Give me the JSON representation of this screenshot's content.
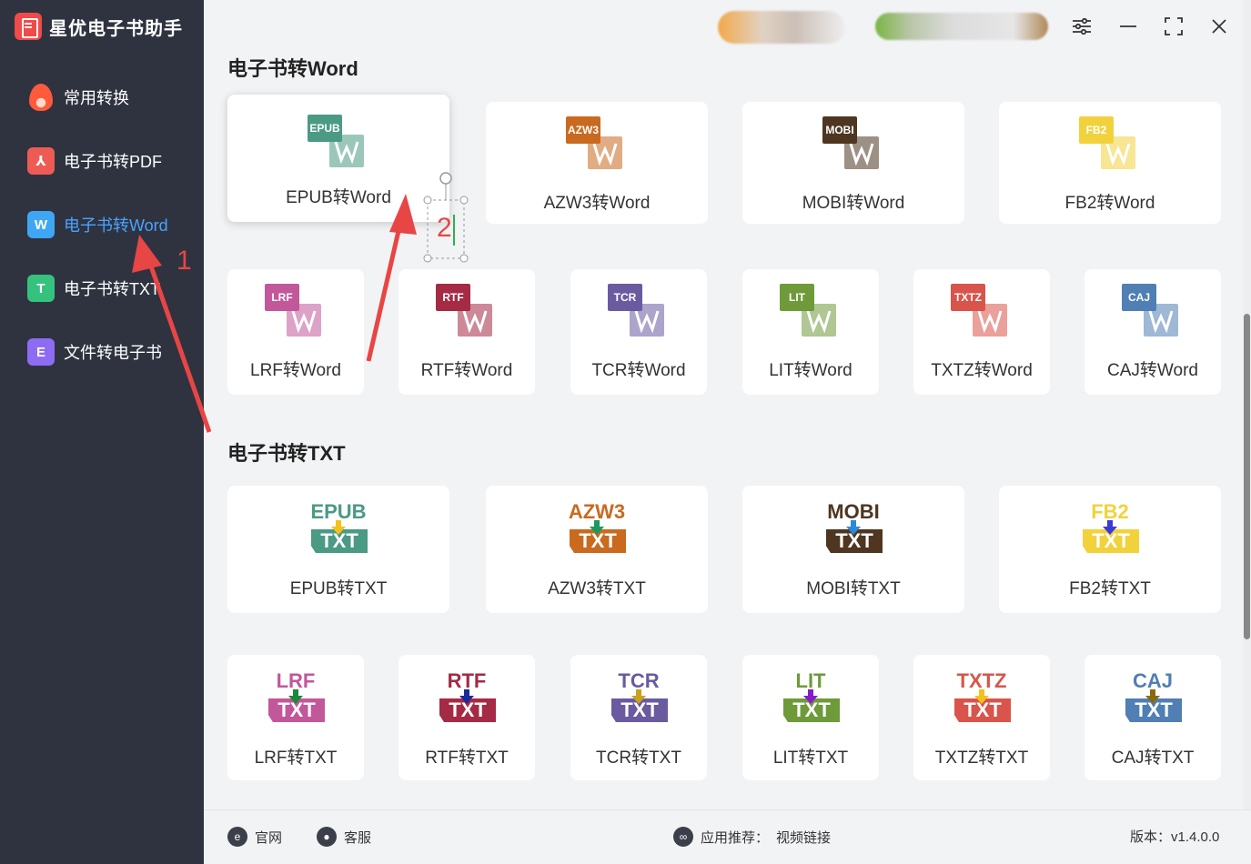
{
  "app": {
    "title": "星优电子书助手"
  },
  "sidebar": {
    "items": [
      {
        "label": "常用转换",
        "icon": "fire-icon"
      },
      {
        "label": "电子书转PDF",
        "icon": "pdf-icon"
      },
      {
        "label": "电子书转Word",
        "icon": "word-icon",
        "active": true
      },
      {
        "label": "电子书转TXT",
        "icon": "txt-icon"
      },
      {
        "label": "文件转电子书",
        "icon": "ebook-icon"
      }
    ]
  },
  "annotations": {
    "step1": "1",
    "step2": "2"
  },
  "sections": {
    "word": {
      "title": "电子书转Word",
      "cards": [
        {
          "fmt": "EPUB",
          "label": "EPUB转Word",
          "color": "#4a9a84"
        },
        {
          "fmt": "AZW3",
          "label": "AZW3转Word",
          "color": "#c96a1f"
        },
        {
          "fmt": "MOBI",
          "label": "MOBI转Word",
          "color": "#4e3621"
        },
        {
          "fmt": "FB2",
          "label": "FB2转Word",
          "color": "#f2d23c"
        },
        {
          "fmt": "LRF",
          "label": "LRF转Word",
          "color": "#c2579a"
        },
        {
          "fmt": "RTF",
          "label": "RTF转Word",
          "color": "#a52a44"
        },
        {
          "fmt": "TCR",
          "label": "TCR转Word",
          "color": "#6a5aa0"
        },
        {
          "fmt": "LIT",
          "label": "LIT转Word",
          "color": "#6e9a3a"
        },
        {
          "fmt": "TXTZ",
          "label": "TXTZ转Word",
          "color": "#d9544a"
        },
        {
          "fmt": "CAJ",
          "label": "CAJ转Word",
          "color": "#4f7fb3"
        }
      ]
    },
    "txt": {
      "title": "电子书转TXT",
      "cards": [
        {
          "fmt": "EPUB",
          "label": "EPUB转TXT",
          "color": "#4a9a84",
          "arrow": "#f2c21a"
        },
        {
          "fmt": "AZW3",
          "label": "AZW3转TXT",
          "color": "#c96a1f",
          "arrow": "#1a9a5a"
        },
        {
          "fmt": "MOBI",
          "label": "MOBI转TXT",
          "color": "#4e3621",
          "arrow": "#2a8ad9"
        },
        {
          "fmt": "FB2",
          "label": "FB2转TXT",
          "color": "#f2d23c",
          "arrow": "#3a3ad9"
        },
        {
          "fmt": "LRF",
          "label": "LRF转TXT",
          "color": "#c2579a",
          "arrow": "#1a8a3a"
        },
        {
          "fmt": "RTF",
          "label": "RTF转TXT",
          "color": "#a52a44",
          "arrow": "#1a2a9a"
        },
        {
          "fmt": "TCR",
          "label": "TCR转TXT",
          "color": "#6a5aa0",
          "arrow": "#c9a21a"
        },
        {
          "fmt": "LIT",
          "label": "LIT转TXT",
          "color": "#6e9a3a",
          "arrow": "#8a1ac9"
        },
        {
          "fmt": "TXTZ",
          "label": "TXTZ转TXT",
          "color": "#d9544a",
          "arrow": "#f2c21a"
        },
        {
          "fmt": "CAJ",
          "label": "CAJ转TXT",
          "color": "#4f7fb3",
          "arrow": "#8a6a10"
        }
      ]
    }
  },
  "footer": {
    "website": "官网",
    "service": "客服",
    "recommend_label": "应用推荐：",
    "recommend_link": "视频链接",
    "version": "版本：v1.4.0.0"
  }
}
